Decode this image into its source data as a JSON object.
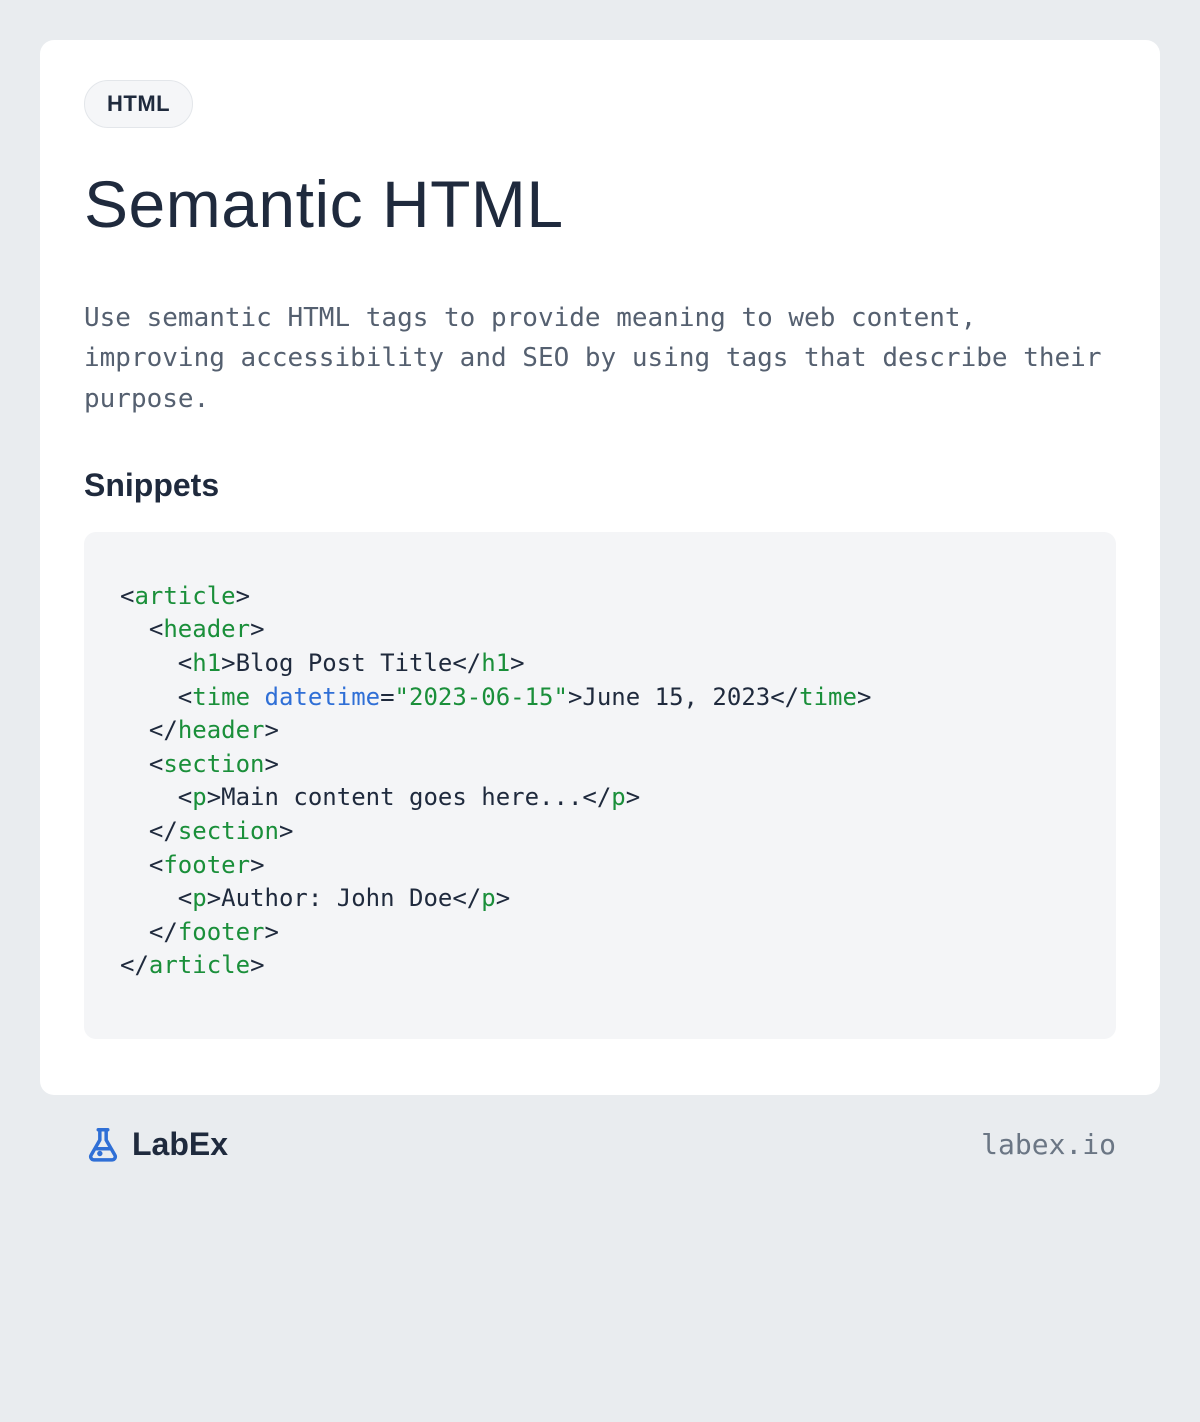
{
  "badge": "HTML",
  "title": "Semantic HTML",
  "description": "Use semantic HTML tags to provide meaning to web content, improving accessibility and SEO by using tags that describe their purpose.",
  "snippets_heading": "Snippets",
  "code": {
    "lines": [
      {
        "indent": 0,
        "parts": [
          {
            "t": "punc",
            "v": "<"
          },
          {
            "t": "tag",
            "v": "article"
          },
          {
            "t": "punc",
            "v": ">"
          }
        ]
      },
      {
        "indent": 1,
        "parts": [
          {
            "t": "punc",
            "v": "<"
          },
          {
            "t": "tag",
            "v": "header"
          },
          {
            "t": "punc",
            "v": ">"
          }
        ]
      },
      {
        "indent": 2,
        "parts": [
          {
            "t": "punc",
            "v": "<"
          },
          {
            "t": "tag",
            "v": "h1"
          },
          {
            "t": "punc",
            "v": ">"
          },
          {
            "t": "text",
            "v": "Blog Post Title"
          },
          {
            "t": "punc",
            "v": "</"
          },
          {
            "t": "tag",
            "v": "h1"
          },
          {
            "t": "punc",
            "v": ">"
          }
        ]
      },
      {
        "indent": 2,
        "parts": [
          {
            "t": "punc",
            "v": "<"
          },
          {
            "t": "tag",
            "v": "time"
          },
          {
            "t": "text",
            "v": " "
          },
          {
            "t": "attr",
            "v": "datetime"
          },
          {
            "t": "punc",
            "v": "="
          },
          {
            "t": "str",
            "v": "\"2023-06-15\""
          },
          {
            "t": "punc",
            "v": ">"
          },
          {
            "t": "text",
            "v": "June 15, 2023"
          },
          {
            "t": "punc",
            "v": "</"
          },
          {
            "t": "tag",
            "v": "time"
          },
          {
            "t": "punc",
            "v": ">"
          }
        ]
      },
      {
        "indent": 1,
        "parts": [
          {
            "t": "punc",
            "v": "</"
          },
          {
            "t": "tag",
            "v": "header"
          },
          {
            "t": "punc",
            "v": ">"
          }
        ]
      },
      {
        "indent": 1,
        "parts": [
          {
            "t": "punc",
            "v": "<"
          },
          {
            "t": "tag",
            "v": "section"
          },
          {
            "t": "punc",
            "v": ">"
          }
        ]
      },
      {
        "indent": 2,
        "parts": [
          {
            "t": "punc",
            "v": "<"
          },
          {
            "t": "tag",
            "v": "p"
          },
          {
            "t": "punc",
            "v": ">"
          },
          {
            "t": "text",
            "v": "Main content goes here..."
          },
          {
            "t": "punc",
            "v": "</"
          },
          {
            "t": "tag",
            "v": "p"
          },
          {
            "t": "punc",
            "v": ">"
          }
        ]
      },
      {
        "indent": 1,
        "parts": [
          {
            "t": "punc",
            "v": "</"
          },
          {
            "t": "tag",
            "v": "section"
          },
          {
            "t": "punc",
            "v": ">"
          }
        ]
      },
      {
        "indent": 1,
        "parts": [
          {
            "t": "punc",
            "v": "<"
          },
          {
            "t": "tag",
            "v": "footer"
          },
          {
            "t": "punc",
            "v": ">"
          }
        ]
      },
      {
        "indent": 2,
        "parts": [
          {
            "t": "punc",
            "v": "<"
          },
          {
            "t": "tag",
            "v": "p"
          },
          {
            "t": "punc",
            "v": ">"
          },
          {
            "t": "text",
            "v": "Author: John Doe"
          },
          {
            "t": "punc",
            "v": "</"
          },
          {
            "t": "tag",
            "v": "p"
          },
          {
            "t": "punc",
            "v": ">"
          }
        ]
      },
      {
        "indent": 1,
        "parts": [
          {
            "t": "punc",
            "v": "</"
          },
          {
            "t": "tag",
            "v": "footer"
          },
          {
            "t": "punc",
            "v": ">"
          }
        ]
      },
      {
        "indent": 0,
        "parts": [
          {
            "t": "punc",
            "v": "</"
          },
          {
            "t": "tag",
            "v": "article"
          },
          {
            "t": "punc",
            "v": ">"
          }
        ]
      }
    ]
  },
  "brand": {
    "name": "LabEx",
    "url": "labex.io",
    "icon": "flask-icon",
    "icon_color": "#2f6fd6"
  }
}
